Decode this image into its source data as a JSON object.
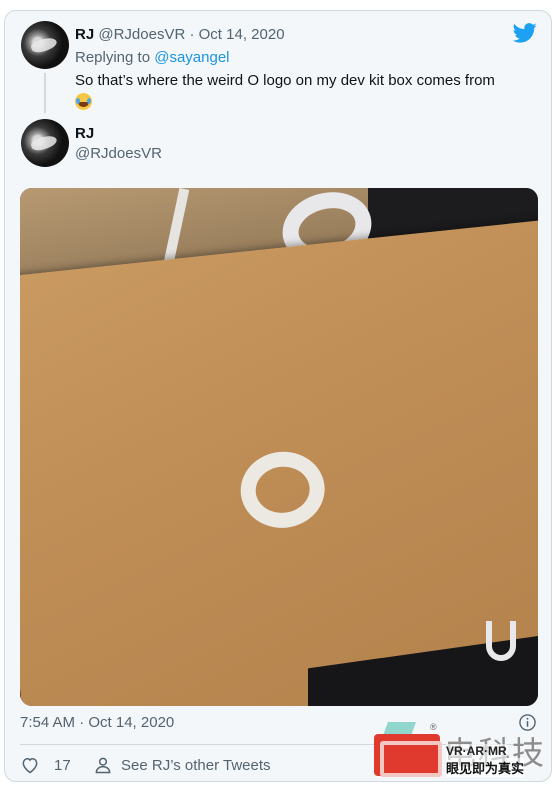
{
  "reply_tweet": {
    "name": "RJ",
    "handle": "@RJdoesVR",
    "separator": " · ",
    "date": "Oct 14, 2020",
    "replying_to_label": "Replying to ",
    "replying_to_handle": "@sayangel",
    "text": "So that’s where the weird O logo on my dev kit box comes from",
    "emoji": "face-with-tears-of-joy"
  },
  "main_tweet": {
    "name": "RJ",
    "handle": "@RJdoesVR",
    "timestamp": "7:54 AM · Oct 14, 2020",
    "like_count": "17",
    "see_other_tweets": "See RJ’s other Tweets"
  },
  "icons": {
    "brand": "twitter-bird-icon",
    "info": "info-icon",
    "like": "heart-icon",
    "profile": "person-icon"
  },
  "colors": {
    "twitter_blue": "#1da1f2",
    "link": "#1b95e0",
    "muted_text": "#536471",
    "card_background": "#f4f7f9"
  },
  "watermark": {
    "reg": "®",
    "big_text": "电科技",
    "tagline1": "VR·AR·MR",
    "tagline2": "眼见即为真实"
  }
}
